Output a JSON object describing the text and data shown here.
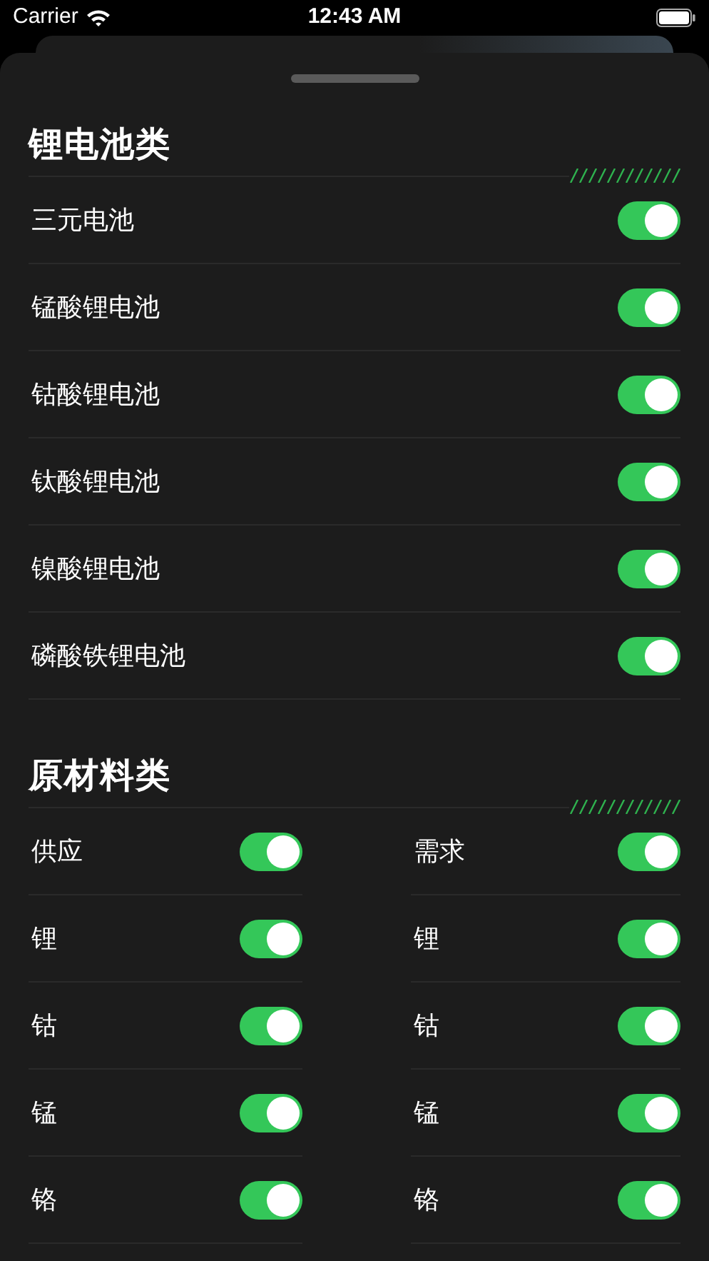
{
  "status_bar": {
    "carrier": "Carrier",
    "time": "12:43 AM"
  },
  "sections": [
    {
      "title": "锂电池类",
      "kind": "list",
      "items": [
        {
          "label": "三元电池",
          "on": true
        },
        {
          "label": "锰酸锂电池",
          "on": true
        },
        {
          "label": "钴酸锂电池",
          "on": true
        },
        {
          "label": "钛酸锂电池",
          "on": true
        },
        {
          "label": "镍酸锂电池",
          "on": true
        },
        {
          "label": "磷酸铁锂电池",
          "on": true
        }
      ]
    },
    {
      "title": "原材料类",
      "kind": "columns",
      "columns": [
        {
          "items": [
            {
              "label": "供应",
              "on": true
            },
            {
              "label": "锂",
              "on": true
            },
            {
              "label": "钴",
              "on": true
            },
            {
              "label": "锰",
              "on": true
            },
            {
              "label": "铬",
              "on": true
            }
          ]
        },
        {
          "items": [
            {
              "label": "需求",
              "on": true
            },
            {
              "label": "锂",
              "on": true
            },
            {
              "label": "钴",
              "on": true
            },
            {
              "label": "锰",
              "on": true
            },
            {
              "label": "铬",
              "on": true
            }
          ]
        }
      ]
    }
  ]
}
